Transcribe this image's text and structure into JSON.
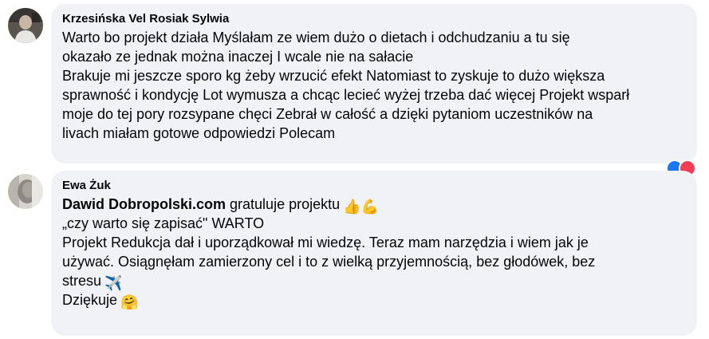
{
  "comments": [
    {
      "author": "Krzesińska Vel Rosiak Sylwia",
      "lines": [
        "Warto bo projekt działa Myślałam ze wiem dużo o dietach i odchudzaniu a tu się",
        "okazało ze jednak można inaczej I wcale nie na sałacie",
        "Brakuje mi jeszcze sporo kg żeby wrzucić efekt Natomiast to zyskuje to dużo większa",
        "sprawność i kondycję Lot wymusza a chcąc lecieć wyżej trzeba dać więcej Projekt wsparł",
        "moje do tej pory rozsypane chęci Zebrał w całość a dzięki pytaniom uczestników na",
        "livach miałam gotowe odpowiedzi Polecam"
      ],
      "reaction_icons": [
        "like-reaction-icon",
        "love-reaction-icon"
      ]
    },
    {
      "author": "Ewa Żuk",
      "mention": "Dawid Dobropolski.com",
      "first_line_rest": " gratuluje projektu",
      "first_line_emoji": "👍💪",
      "lines": [
        "„czy warto się zapisać\" WARTO",
        "Projekt Redukcja dał i uporządkował mi wiedzę. Teraz mam narzędzia i wiem jak je",
        "używać. Osiągnęłam zamierzony cel i to z wielką przyjemnością, bez głodówek, bez",
        "stresu"
      ],
      "stresu_emoji": "✈️",
      "thanks": "Dziękuje",
      "thanks_emoji": "🤗"
    }
  ],
  "colors": {
    "bubble_bg": "#f0f2f5",
    "text": "#050505",
    "like_blue": "#1877f2",
    "love_red": "#f33e58"
  }
}
